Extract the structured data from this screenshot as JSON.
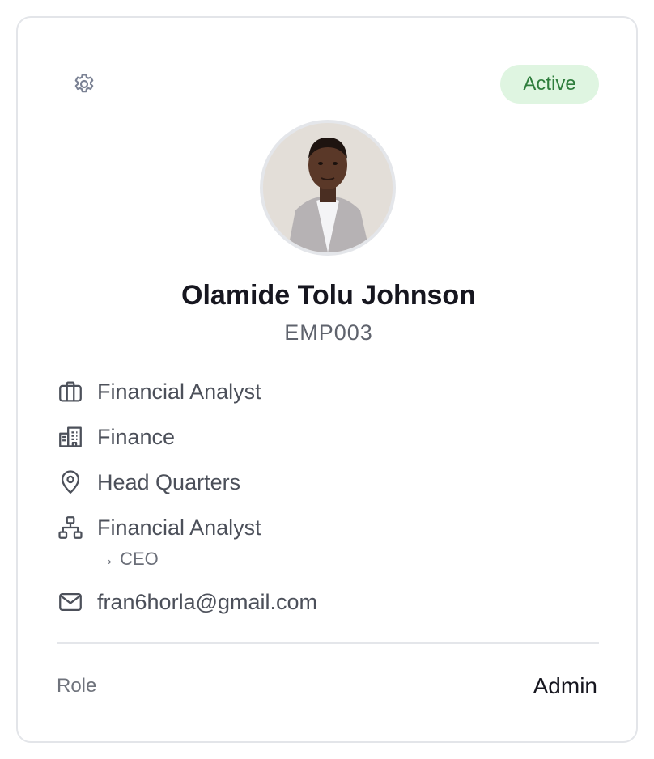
{
  "card": {
    "status": "Active",
    "name": "Olamide Tolu Johnson",
    "employee_id": "EMP003",
    "details": {
      "position": "Financial Analyst",
      "department": "Finance",
      "location": "Head Quarters",
      "reporting_role": "Financial Analyst",
      "reports_to": "→ CEO",
      "email": "fran6horla@gmail.com"
    },
    "role_label": "Role",
    "role_value": "Admin"
  },
  "icons": {
    "settings": "gear-icon",
    "position": "briefcase-icon",
    "department": "building-icon",
    "location": "map-pin-icon",
    "hierarchy": "org-chart-icon",
    "email": "mail-icon"
  },
  "colors": {
    "status_bg": "#dff5e1",
    "status_text": "#2e7d3c",
    "icon": "#4c505a",
    "gear": "#7b8294"
  }
}
